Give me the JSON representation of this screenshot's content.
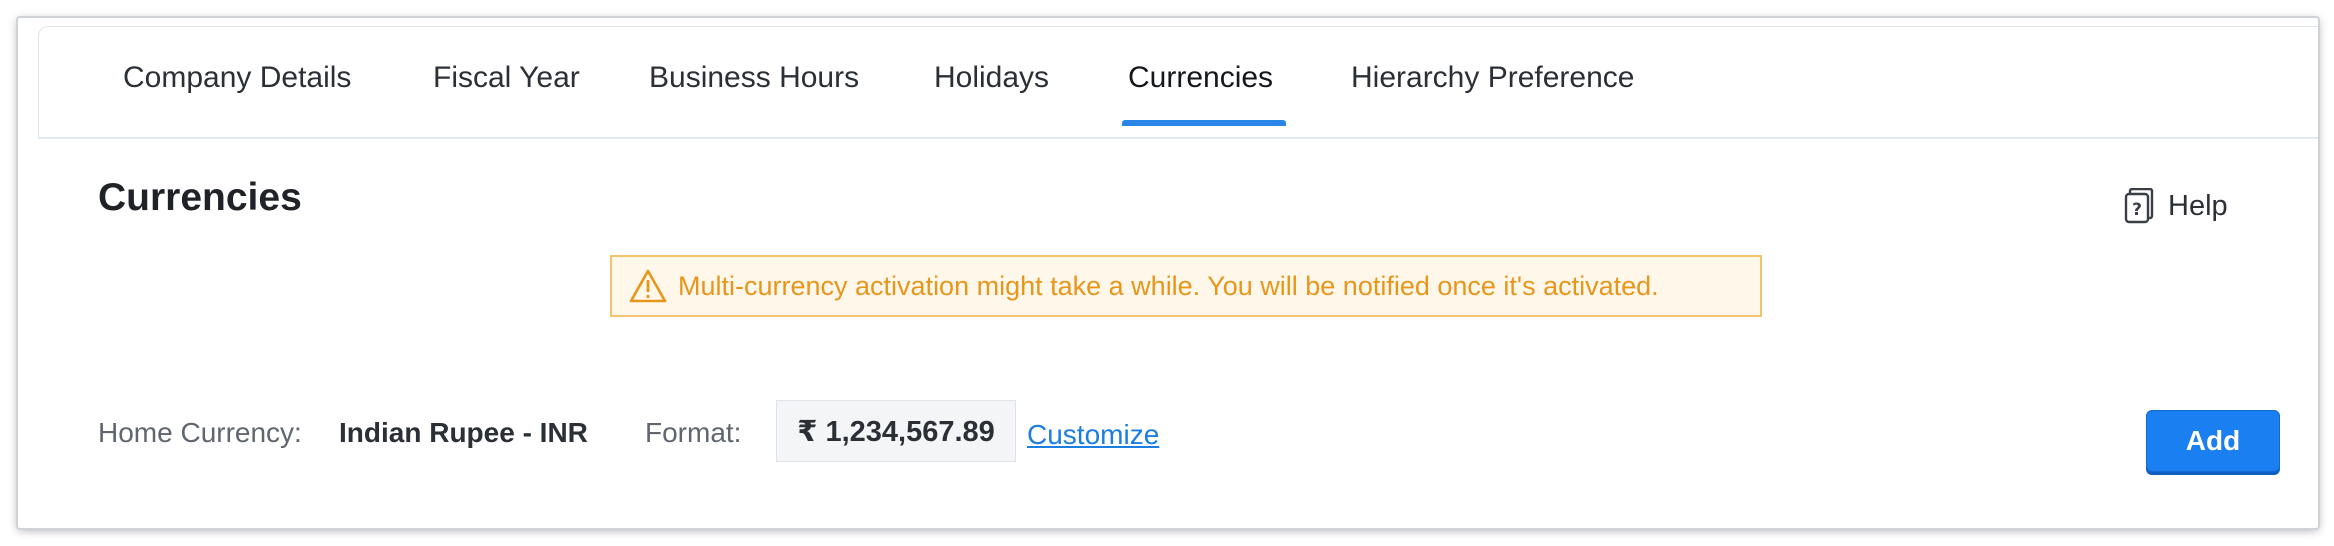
{
  "tabs": [
    {
      "label": "Company Details",
      "active": false
    },
    {
      "label": "Fiscal Year",
      "active": false
    },
    {
      "label": "Business Hours",
      "active": false
    },
    {
      "label": "Holidays",
      "active": false
    },
    {
      "label": "Currencies",
      "active": true
    },
    {
      "label": "Hierarchy Preference",
      "active": false
    }
  ],
  "page": {
    "title": "Currencies",
    "help_label": "Help",
    "help_icon": "help-book-icon"
  },
  "banner": {
    "icon": "warning-triangle-icon",
    "text": "Multi-currency activation might take a while. You will be notified once it's activated.",
    "color": "#e8961b",
    "background": "#fff8ea",
    "border": "#f3c46d"
  },
  "currency_row": {
    "home_label": "Home Currency:",
    "home_value": "Indian Rupee - INR",
    "format_label": "Format:",
    "format_value": "₹ 1,234,567.89",
    "customize_label": "Customize",
    "add_label": "Add"
  },
  "colors": {
    "accent": "#2a86e6",
    "primary_button": "#1a7ff0",
    "link": "#1b7ee0"
  }
}
